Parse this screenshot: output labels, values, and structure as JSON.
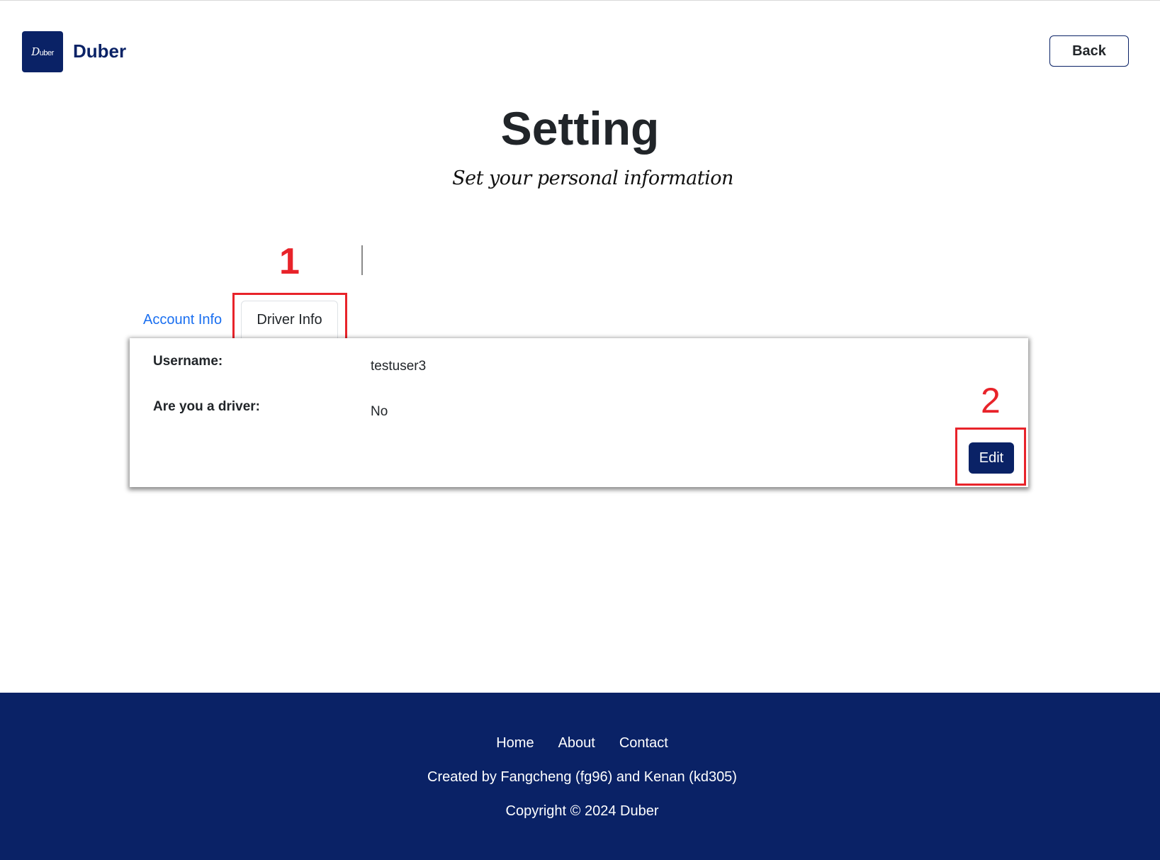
{
  "header": {
    "logo_text": "Duber",
    "brand_name": "Duber",
    "back_label": "Back"
  },
  "page": {
    "title": "Setting",
    "subtitle": "Set your personal information"
  },
  "annotations": {
    "one": "1",
    "two": "2"
  },
  "tabs": [
    {
      "label": "Account Info",
      "active": false
    },
    {
      "label": "Driver Info",
      "active": true
    }
  ],
  "card": {
    "fields": [
      {
        "label": "Username:",
        "value": "testuser3"
      },
      {
        "label": "Are you a driver:",
        "value": "No"
      }
    ],
    "edit_label": "Edit"
  },
  "footer": {
    "links": [
      "Home",
      "About",
      "Contact"
    ],
    "credits": "Created by Fangcheng (fg96) and Kenan (kd305)",
    "copyright": "Copyright © 2024 Duber"
  },
  "colors": {
    "brand": "#0a2266",
    "link": "#1a6ff0",
    "annotation": "#e8232a"
  }
}
